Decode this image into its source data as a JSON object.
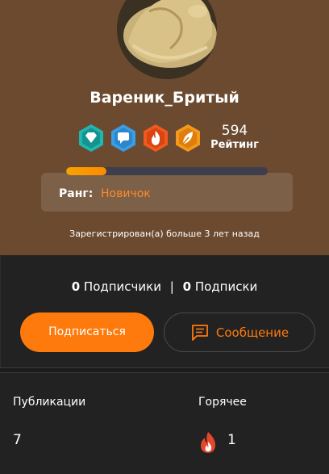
{
  "profile": {
    "username": "Вареник_Бритый",
    "avatar_icon": "dumpling-avatar",
    "badges": [
      {
        "icon": "diamond-icon",
        "color": "#1fb7b2"
      },
      {
        "icon": "chat-icon",
        "color": "#3a9ee6"
      },
      {
        "icon": "fire-icon",
        "color": "#f05a1f"
      },
      {
        "icon": "flame-leaf-icon",
        "color": "#f29a1d"
      }
    ],
    "rating_value": "594",
    "rating_label": "Рейтинг",
    "progress_fraction": 0.2,
    "rank_label": "Ранг:",
    "rank_value": "Новичок",
    "registered_text": "Зарегистрирован(а) больше 3 лет назад"
  },
  "social": {
    "followers_count": "0",
    "followers_label": "Подписчики",
    "separator": "|",
    "following_count": "0",
    "following_label": "Подписки",
    "subscribe_label": "Подписаться",
    "message_label": "Сообщение"
  },
  "stats": {
    "publications_label": "Публикации",
    "publications_value": "7",
    "hot_label": "Горячее",
    "hot_value": "1",
    "hot_icon": "fire-icon"
  },
  "colors": {
    "accent": "#ff7a0c",
    "rank": "#ff8a2a",
    "hero_bg": "#6b4a2f",
    "page_bg": "#222222"
  }
}
